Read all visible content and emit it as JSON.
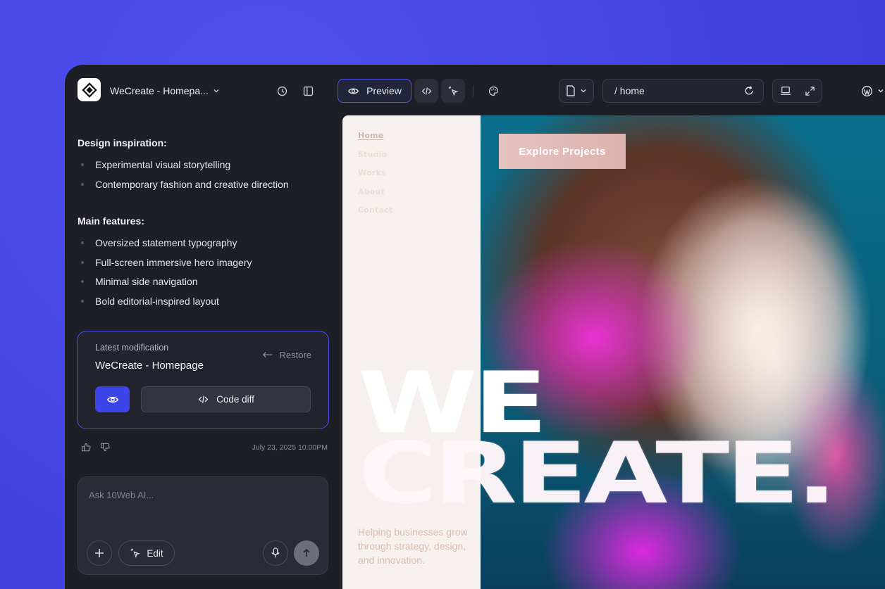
{
  "topbar": {
    "project_title": "WeCreate - Homepa...",
    "preview_label": "Preview",
    "url_path": "/ home"
  },
  "chat": {
    "sections": [
      {
        "title": "Design inspiration:",
        "items": [
          "Experimental visual storytelling",
          "Contemporary fashion and creative direction"
        ]
      },
      {
        "title": "Main features:",
        "items": [
          "Oversized statement typography",
          "Full-screen immersive hero imagery",
          "Minimal side navigation",
          "Bold editorial-inspired layout"
        ]
      }
    ],
    "modification": {
      "label": "Latest modification",
      "name": "WeCreate - Homepage",
      "restore_label": "Restore",
      "code_diff_label": "Code diff"
    },
    "timestamp": "July 23, 2025 10:00PM",
    "composer": {
      "placeholder": "Ask 10Web AI...",
      "edit_label": "Edit"
    }
  },
  "site": {
    "nav": [
      "Home",
      "Studio",
      "Works",
      "About",
      "Contact"
    ],
    "cta_label": "Explore Projects",
    "headline_line1": "WE",
    "headline_line2": "CREATE.",
    "tagline": "Helping businesses grow through strategy, design, and innovation."
  },
  "colors": {
    "background": "#4546e6",
    "panel": "#1d1e26",
    "accent": "#3d45e8"
  }
}
